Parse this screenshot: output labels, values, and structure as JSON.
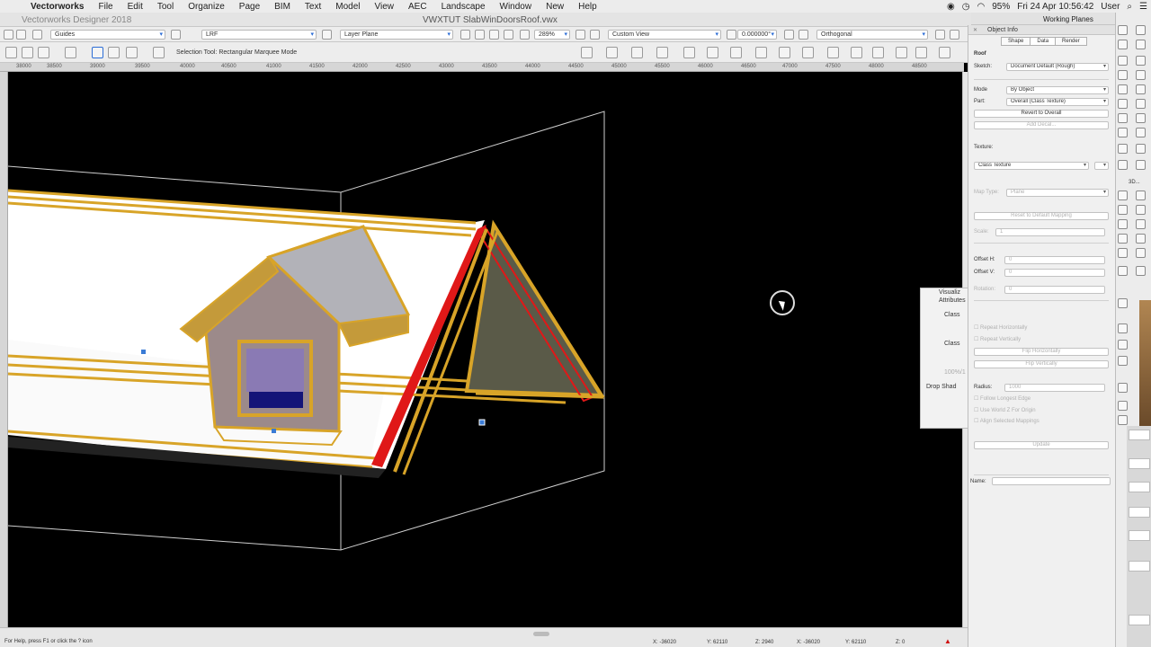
{
  "menubar": {
    "app": "Vectorworks",
    "items": [
      "File",
      "Edit",
      "Tool",
      "Organize",
      "Page",
      "BIM",
      "Text",
      "Model",
      "View",
      "AEC",
      "Landscape",
      "Window",
      "New",
      "Help"
    ],
    "battery": "95%",
    "clock": "Fri 24 Apr  10:56:42",
    "user": "User"
  },
  "window": {
    "app_title": "Vectorworks Designer 2018",
    "doc_title": "VWXTUT SlabWinDoorsRoof.vwx"
  },
  "view_bar": {
    "class": "Guides",
    "layer": "LRF",
    "layer_plane": "Layer Plane",
    "zoom": "289%",
    "view": "Custom View",
    "rotation": "0.000000°",
    "projection": "Orthogonal"
  },
  "mode_bar": {
    "hint": "Selection Tool: Rectangular Marquee Mode"
  },
  "rulers": {
    "horizontal": [
      "38000",
      "38500",
      "39000",
      "39500",
      "40000",
      "40500",
      "41000",
      "41500",
      "42000",
      "42500",
      "43000",
      "43500",
      "44000",
      "44500",
      "45000",
      "45500",
      "46000",
      "46500",
      "47000",
      "47500",
      "48000",
      "48500"
    ]
  },
  "status_bar": {
    "help": "For Help, press F1 or click the ? icon",
    "x1": "X: -36020",
    "y1": "Y: 62110",
    "z1": "Z: 2940",
    "x2": "X: -36020",
    "y2": "Y: 62110",
    "z2": "Z: 0"
  },
  "attributes_palette": {
    "title1": "Visualiz",
    "title2": "Attributes",
    "fill": "Class",
    "pen": "Class",
    "opacity": "100%/1",
    "drop_shadow": "Drop Shad"
  },
  "working_planes": {
    "title": "Working Planes"
  },
  "object_info": {
    "title": "Object Info",
    "tabs": [
      "Shape",
      "Data",
      "Render"
    ],
    "object_type": "Roof",
    "sketch_label": "Sketch:",
    "sketch_value": "Document Default (Rough)",
    "mode_label": "Mode",
    "mode_value": "By Object",
    "part_label": "Part:",
    "part_value": "Overall (Class Texture)",
    "revert_button": "Revert to Overall",
    "add_decal_button": "Add Decal...",
    "texture_label": "Texture:",
    "texture_value": "Class Texture",
    "map_type_label": "Map Type:",
    "map_type_value": "Plane",
    "reset_mapping_button": "Reset to Default Mapping",
    "scale_label": "Scale:",
    "scale_value": "1",
    "offset_h_label": "Offset H:",
    "offset_h_value": "0",
    "offset_v_label": "Offset V:",
    "offset_v_value": "0",
    "rotation_label": "Rotation:",
    "rotation_value": "0",
    "repeat_h": "Repeat Horizontally",
    "repeat_v": "Repeat Vertically",
    "flip_h_button": "Flip Horizontally",
    "flip_v_button": "Flip Vertically",
    "radius_label": "Radius:",
    "radius_value": "1000",
    "follow_edge": "Follow Longest Edge",
    "use_world_z": "Use World Z For Origin",
    "align_mappings": "Align Selected Mappings",
    "update_button": "Update",
    "name_label": "Name:"
  },
  "toolset": {
    "header_3d": "3D..."
  },
  "colors": {
    "accent": "#2d6ed6",
    "roof_gold": "#d8a428",
    "highlight_red": "#e01818",
    "canvas_bg": "#000000"
  }
}
